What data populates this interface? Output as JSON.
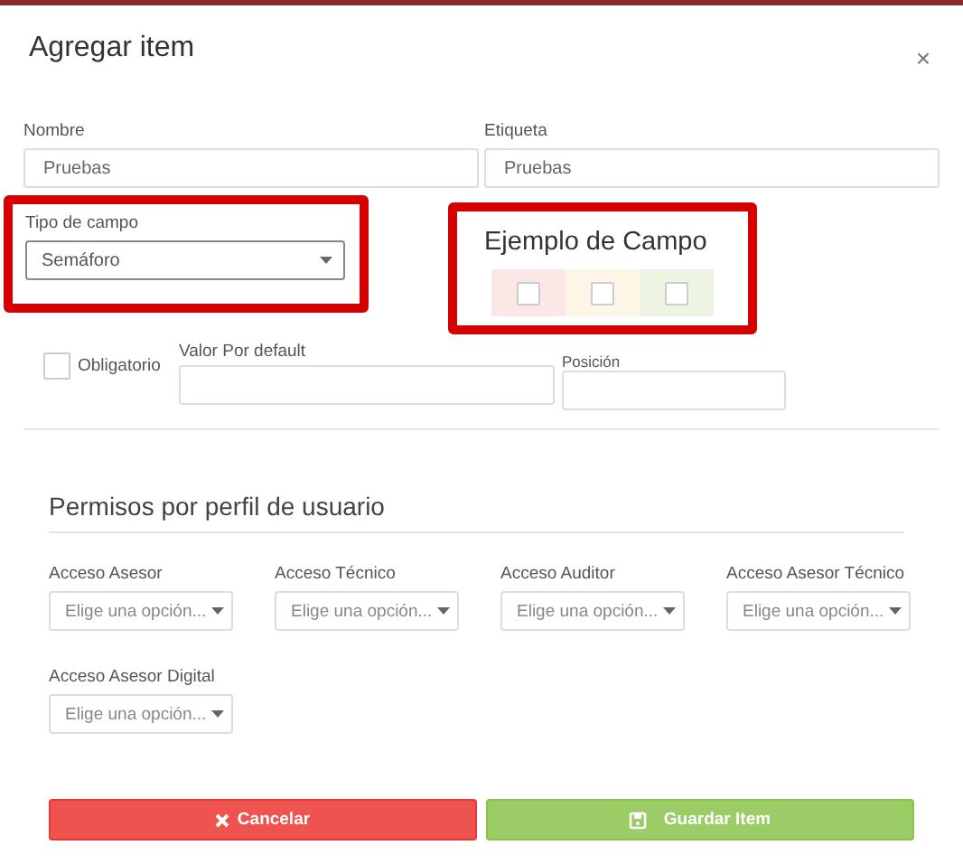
{
  "dialog": {
    "title": "Agregar item",
    "close": "×"
  },
  "fields": {
    "nombre": {
      "label": "Nombre",
      "value": "Pruebas"
    },
    "etiqueta": {
      "label": "Etiqueta",
      "value": "Pruebas"
    },
    "tipo": {
      "label": "Tipo de campo",
      "value": "Semáforo"
    },
    "obligatorio": {
      "label": "Obligatorio",
      "checked": false
    },
    "valor": {
      "label": "Valor Por default"
    },
    "posicion": {
      "label": "Posición"
    }
  },
  "example": {
    "title": "Ejemplo de Campo",
    "cells": [
      {
        "color": "#fbe8e6",
        "checked": false
      },
      {
        "color": "#fdf6e6",
        "checked": false
      },
      {
        "color": "#edf5e2",
        "checked": false
      }
    ]
  },
  "permissions": {
    "title": "Permisos por perfil de usuario",
    "items": [
      {
        "label": "Acceso Asesor",
        "placeholder": "Elige una opción..."
      },
      {
        "label": "Acceso Técnico",
        "placeholder": "Elige una opción..."
      },
      {
        "label": "Acceso Auditor",
        "placeholder": "Elige una opción..."
      },
      {
        "label": "Acceso Asesor Técnico",
        "placeholder": "Elige una opción..."
      },
      {
        "label": "Acceso Asesor Digital",
        "placeholder": "Elige una opción..."
      }
    ]
  },
  "buttons": {
    "cancel": "Cancelar",
    "save": "Guardar Item"
  }
}
